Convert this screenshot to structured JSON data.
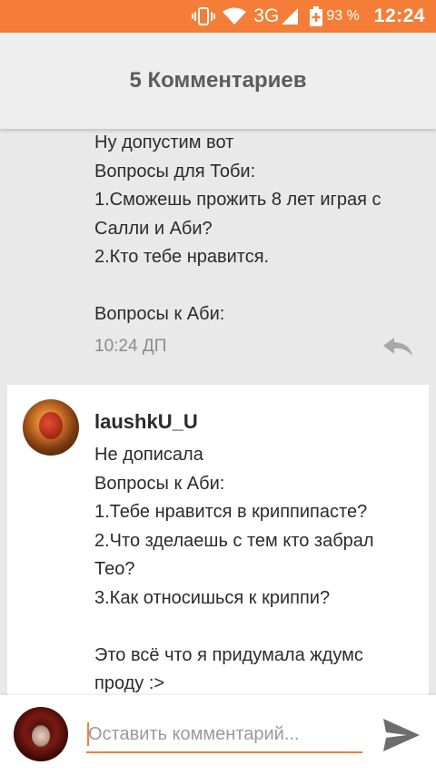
{
  "status_bar": {
    "network": "3G",
    "battery_percent": "93 %",
    "time": "12:24"
  },
  "header": {
    "title": "5 Комментариев"
  },
  "comments": [
    {
      "lines": [
        "Ну допустим вот",
        "Вопросы для Тоби:",
        "1.Сможешь прожить 8 лет играя с",
        "Салли и Аби?",
        "2.Кто тебе нравится.",
        "",
        "Вопросы к Аби:"
      ],
      "time": "10:24 ДП"
    },
    {
      "username": "laushkU_U",
      "lines": [
        "Не дописала",
        "Вопросы к Аби:",
        "1.Тебе нравится в криппипасте?",
        "2.Что зделаешь с тем кто забрал",
        "Тео?",
        "3.Как относишься к криппи?",
        "",
        "Это всё что я придумала ждумс",
        "проду  :>"
      ]
    }
  ],
  "comment_input": {
    "placeholder": "Оставить комментарий..."
  },
  "colors": {
    "accent": "#f47e38",
    "background": "#e9e9e9",
    "card": "#ffffff"
  },
  "icons": [
    "vibrate-icon",
    "wifi-icon",
    "signal-icon",
    "battery-icon",
    "reply-icon",
    "send-icon"
  ]
}
